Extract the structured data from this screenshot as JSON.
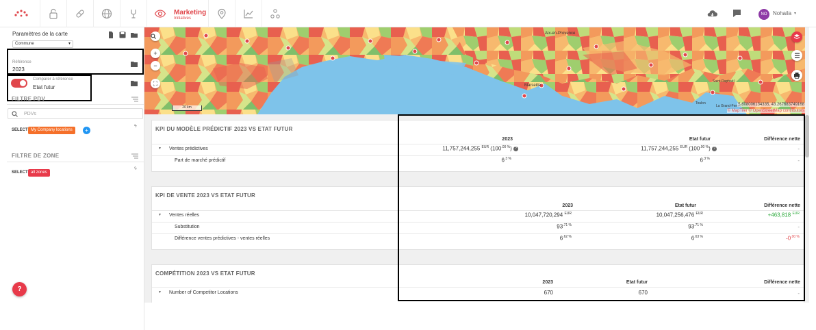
{
  "nav": {
    "marketing_title": "Marketing",
    "marketing_sub": "Initiatives",
    "user_initials": "NO",
    "user_name": "Nohaila"
  },
  "sidebar": {
    "title": "Paramètres de la carte",
    "granularity": "Commune",
    "reference_label": "Référence",
    "reference_value": "2023",
    "toggle_label": "ON",
    "compare_label": "Comparer à référence",
    "compare_value": "Etat futur",
    "pdv_filter_title": "FILTRE PDV",
    "search_placeholder": "PDVs",
    "select_label": "SELECT",
    "pdv_chip": "My Company locations",
    "zone_filter_title": "FILTRE DE ZONE",
    "zone_select_label": "SELECT",
    "zone_chip": "all zones",
    "help": "?"
  },
  "map": {
    "places": {
      "aix": "Aix-en-Provence",
      "marseille": "Marseille",
      "toulon": "Toulon",
      "frejus": "Saint-Raphaël",
      "gras": "La Grand-Ferrat"
    },
    "scale": "20 km",
    "coords": "5.608006134335, 43.267683749168",
    "attribution": "© MapTiler © OpenStreetMap contributors"
  },
  "cards": [
    {
      "title": "KPI DU MODÈLE PRÉDICTIF 2023 VS ETAT FUTUR",
      "col_a": "2023",
      "col_b": "Etat futur",
      "col_c": "Différence nette",
      "rows": [
        {
          "label": "Ventes prédictives",
          "a": "11,757,244,255",
          "a_unit": "EUR",
          "a_pct": "(100",
          "a_pct_sup": ".00 %",
          "b": "11,757,244,255",
          "b_unit": "EUR",
          "b_pct": "(100",
          "b_pct_sup": ".00 %",
          "c": "-"
        },
        {
          "label": "Part de marché prédictif",
          "a": "6",
          "a_unit": ".3 %",
          "b": "6",
          "b_unit": ".3 %",
          "c": "-"
        }
      ]
    },
    {
      "title": "KPI DE VENTE 2023 VS ETAT FUTUR",
      "col_a": "2023",
      "col_b": "Etat futur",
      "col_c": "Différence nette",
      "rows": [
        {
          "label": "Ventes réelles",
          "a": "10,047,720,294",
          "a_unit": "EUR",
          "b": "10,047,256,476",
          "b_unit": "EUR",
          "c": "+463,818",
          "c_unit": "EUR"
        },
        {
          "label": "Substitution",
          "a": "93",
          "a_unit": ".71 %",
          "b": "93",
          "b_unit": ".71 %",
          "c": "-"
        },
        {
          "label": "Différence ventes prédictives - ventes réelles",
          "a": "6",
          "a_unit": ".62 %",
          "b": "6",
          "b_unit": ".63 %",
          "c": "-0",
          "c_unit": ".00 %"
        }
      ]
    },
    {
      "title": "COMPÉTITION 2023 VS ETAT FUTUR",
      "col_a": "2023",
      "col_b": "Etat futur",
      "col_c": "Différence nette",
      "rows": [
        {
          "label": "Number of Competitor Locations",
          "a": "670",
          "b": "670",
          "c": "-"
        }
      ]
    }
  ],
  "colors": {
    "accent": "#e0474c",
    "positive": "#2eaa3d",
    "chip_orange": "#f5702a",
    "chip_red": "#e83a4a",
    "info_blue": "#2196f3"
  }
}
